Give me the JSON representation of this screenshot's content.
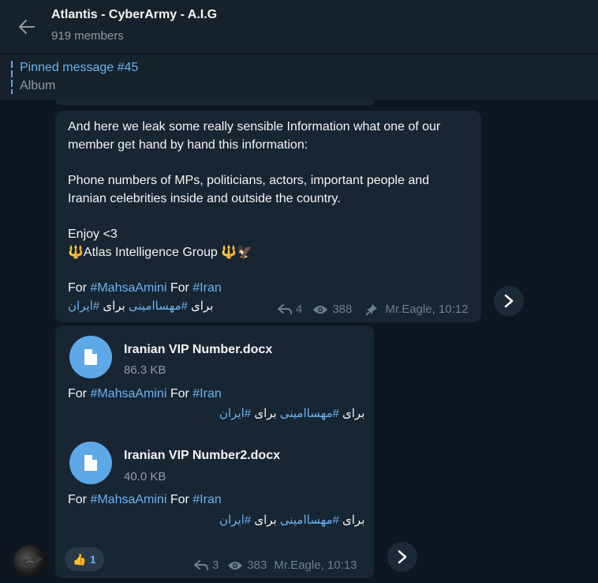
{
  "header": {
    "title": "Atlantis - CyberArmy - A.I.G",
    "members": "919 members"
  },
  "pinned": {
    "title": "Pinned message #45",
    "subtitle": "Album"
  },
  "message1": {
    "lines": [
      "And here we leak some really sensible Information what one of our",
      "member get hand by hand this information:",
      "",
      "Phone numbers of MPs, politicians, actors, important people and",
      "Iranian celebrities inside and outside the country.",
      "",
      "Enjoy <3"
    ],
    "signature_prefix": "🔱",
    "signature": "Atlas Intelligence Group",
    "signature_suffix": "🔱🦅",
    "caption": {
      "for1": "For ",
      "tag1": "#MahsaAmini",
      "for2": " For ",
      "tag2": "#Iran"
    },
    "rtl": {
      "w1": "برای ",
      "tag1": "#مهساامینی",
      "w2": " برای ",
      "tag2": "#ایران"
    },
    "replies": "4",
    "views": "388",
    "author_time": "Mr.Eagle, 10:12"
  },
  "message2": {
    "files": [
      {
        "name": "Iranian VIP Number.docx",
        "size": "86.3 KB",
        "caption": {
          "for1": "For ",
          "tag1": "#MahsaAmini",
          "for2": " For ",
          "tag2": "#Iran"
        },
        "rtl": {
          "w1": "برای ",
          "tag1": "#مهساامینی",
          "w2": " برای ",
          "tag2": "#ایران"
        }
      },
      {
        "name": "Iranian VIP Number2.docx",
        "size": "40.0 KB",
        "caption": {
          "for1": "For ",
          "tag1": "#MahsaAmini",
          "for2": " For ",
          "tag2": "#Iran"
        },
        "rtl": {
          "w1": "برای ",
          "tag1": "#مهساامینی",
          "w2": " برای ",
          "tag2": "#ایران"
        }
      }
    ],
    "reaction": {
      "emoji": "👍",
      "count": "1"
    },
    "replies": "3",
    "views": "383",
    "author_time": "Mr.Eagle, 10:13"
  },
  "colors": {
    "background": "#0e1621",
    "header": "#17212b",
    "bubble": "#182533",
    "accent": "#6ab3f3",
    "file_icon": "#5ea8e8",
    "muted": "#8d9ba8"
  },
  "icons": [
    "back-arrow-icon",
    "reply-icon",
    "eye-icon",
    "pin-icon",
    "share-arrow-icon",
    "document-icon"
  ]
}
